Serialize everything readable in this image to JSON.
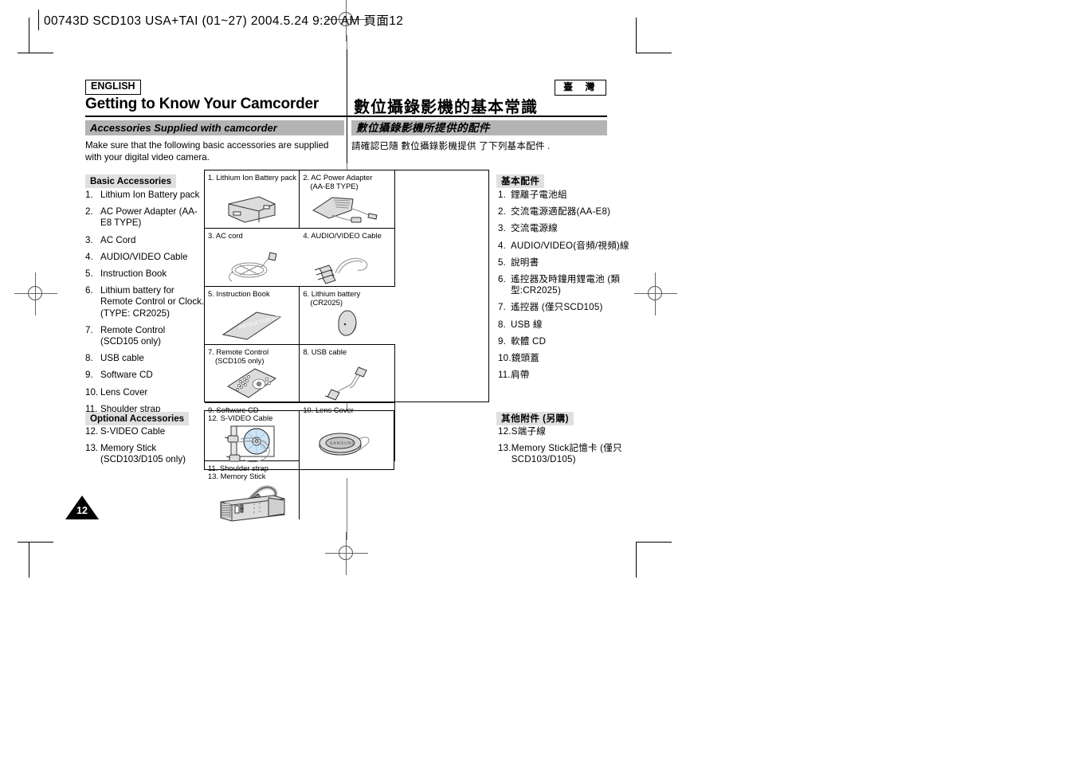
{
  "slug": {
    "text": "00743D SCD103 USA+TAI (01~27)  2004.5.24  9:20 AM  頁面12"
  },
  "header": {
    "english_tag": "ENGLISH",
    "taiwan_tag": "臺 灣",
    "title_en": "Getting to Know Your Camcorder",
    "title_zh": "數位攝錄影機的基本常識"
  },
  "section": {
    "bar_en": "Accessories Supplied with camcorder",
    "bar_zh": "數位攝錄影機所提供的配件",
    "intro_en": "Make sure that the following basic accessories are supplied with your digital video camera.",
    "intro_zh": "請確認已隨 數位攝錄影機提供 了下列基本配件 ."
  },
  "lists": {
    "basic_heading_en": "Basic Accessories",
    "optional_heading_en": "Optional Accessories",
    "basic_heading_zh": "基本配件",
    "optional_heading_zh": "其他附件 (另購)",
    "basic_en": [
      {
        "num": "1.",
        "text": "Lithium Ion Battery pack"
      },
      {
        "num": "2.",
        "text": "AC Power Adapter (AA-E8 TYPE)"
      },
      {
        "num": "3.",
        "text": "AC Cord"
      },
      {
        "num": "4.",
        "text": "AUDIO/VIDEO Cable"
      },
      {
        "num": "5.",
        "text": "Instruction Book"
      },
      {
        "num": "6.",
        "text": "Lithium battery for Remote Control or Clock. (TYPE: CR2025)"
      },
      {
        "num": "7.",
        "text": "Remote Control (SCD105 only)"
      },
      {
        "num": "8.",
        "text": "USB cable"
      },
      {
        "num": "9.",
        "text": "Software CD"
      },
      {
        "num": "10.",
        "text": "Lens Cover"
      },
      {
        "num": "11.",
        "text": "Shoulder strap"
      }
    ],
    "optional_en": [
      {
        "num": "12.",
        "text": "S-VIDEO Cable"
      },
      {
        "num": "13.",
        "text": "Memory Stick (SCD103/D105 only)"
      }
    ],
    "basic_zh": [
      {
        "num": "1.",
        "text": "鋰離子電池組"
      },
      {
        "num": "2.",
        "text": "交流電源適配器(AA-E8)"
      },
      {
        "num": "3.",
        "text": "交流電源線"
      },
      {
        "num": "4.",
        "text": "AUDIO/VIDEO(音頻/視頻)線"
      },
      {
        "num": "5.",
        "text": "說明書"
      },
      {
        "num": "6.",
        "text": "遙控器及時鐘用鋰電池 (類型:CR2025)"
      },
      {
        "num": "7.",
        "text": "遙控器 (僅只SCD105)"
      },
      {
        "num": "8.",
        "text": "USB 線"
      },
      {
        "num": "9.",
        "text": "軟體 CD"
      },
      {
        "num": "10.",
        "text": "鏡頭蓋"
      },
      {
        "num": "11.",
        "text": "肩帶"
      }
    ],
    "optional_zh": [
      {
        "num": "12.",
        "text": "S端子線"
      },
      {
        "num": "13.",
        "text": "Memory Stick記憶卡 (僅只SCD103/D105)"
      }
    ]
  },
  "grid_basic": [
    {
      "icon": "battery-pack-icon",
      "line1": "1. Lithium Ion Battery pack",
      "line2": ""
    },
    {
      "icon": "ac-power-adapter-icon",
      "line1": "2. AC Power Adapter",
      "line2": "(AA-E8 TYPE)"
    },
    {
      "icon": "ac-cord-icon",
      "line1": "3. AC cord",
      "line2": ""
    },
    {
      "icon": "audio-video-cable-icon",
      "line1": "4. AUDIO/VIDEO Cable",
      "line2": ""
    },
    {
      "icon": "instruction-book-icon",
      "line1": "5. Instruction Book",
      "line2": ""
    },
    {
      "icon": "lithium-coin-battery-icon",
      "line1": "6. Lithium battery",
      "line2": "(CR2025)"
    },
    {
      "icon": "remote-control-icon",
      "line1": "7. Remote Control",
      "line2": "(SCD105 only)"
    },
    {
      "icon": "usb-cable-icon",
      "line1": "8. USB cable",
      "line2": ""
    },
    {
      "icon": "software-cd-icon",
      "line1": "9. Software CD",
      "line2": ""
    },
    {
      "icon": "lens-cover-icon",
      "line1": "10. Lens Cover",
      "line2": ""
    },
    {
      "icon": "shoulder-strap-icon",
      "line1": "11. Shoulder strap",
      "line2": ""
    }
  ],
  "grid_optional": [
    {
      "icon": "s-video-cable-icon",
      "line1": "12. S-VIDEO Cable",
      "line2": ""
    },
    {
      "icon": "memory-stick-icon",
      "line1": "13. Memory Stick",
      "line2": ""
    }
  ],
  "footer": {
    "page_number": "12"
  },
  "colors": {
    "bar_gray": "#b4b4b4",
    "section_head_gray": "#e0e0e0",
    "rule_black": "#000000",
    "art_fill": "#d8d8d8",
    "cd_blue": "#cfe4f5"
  }
}
